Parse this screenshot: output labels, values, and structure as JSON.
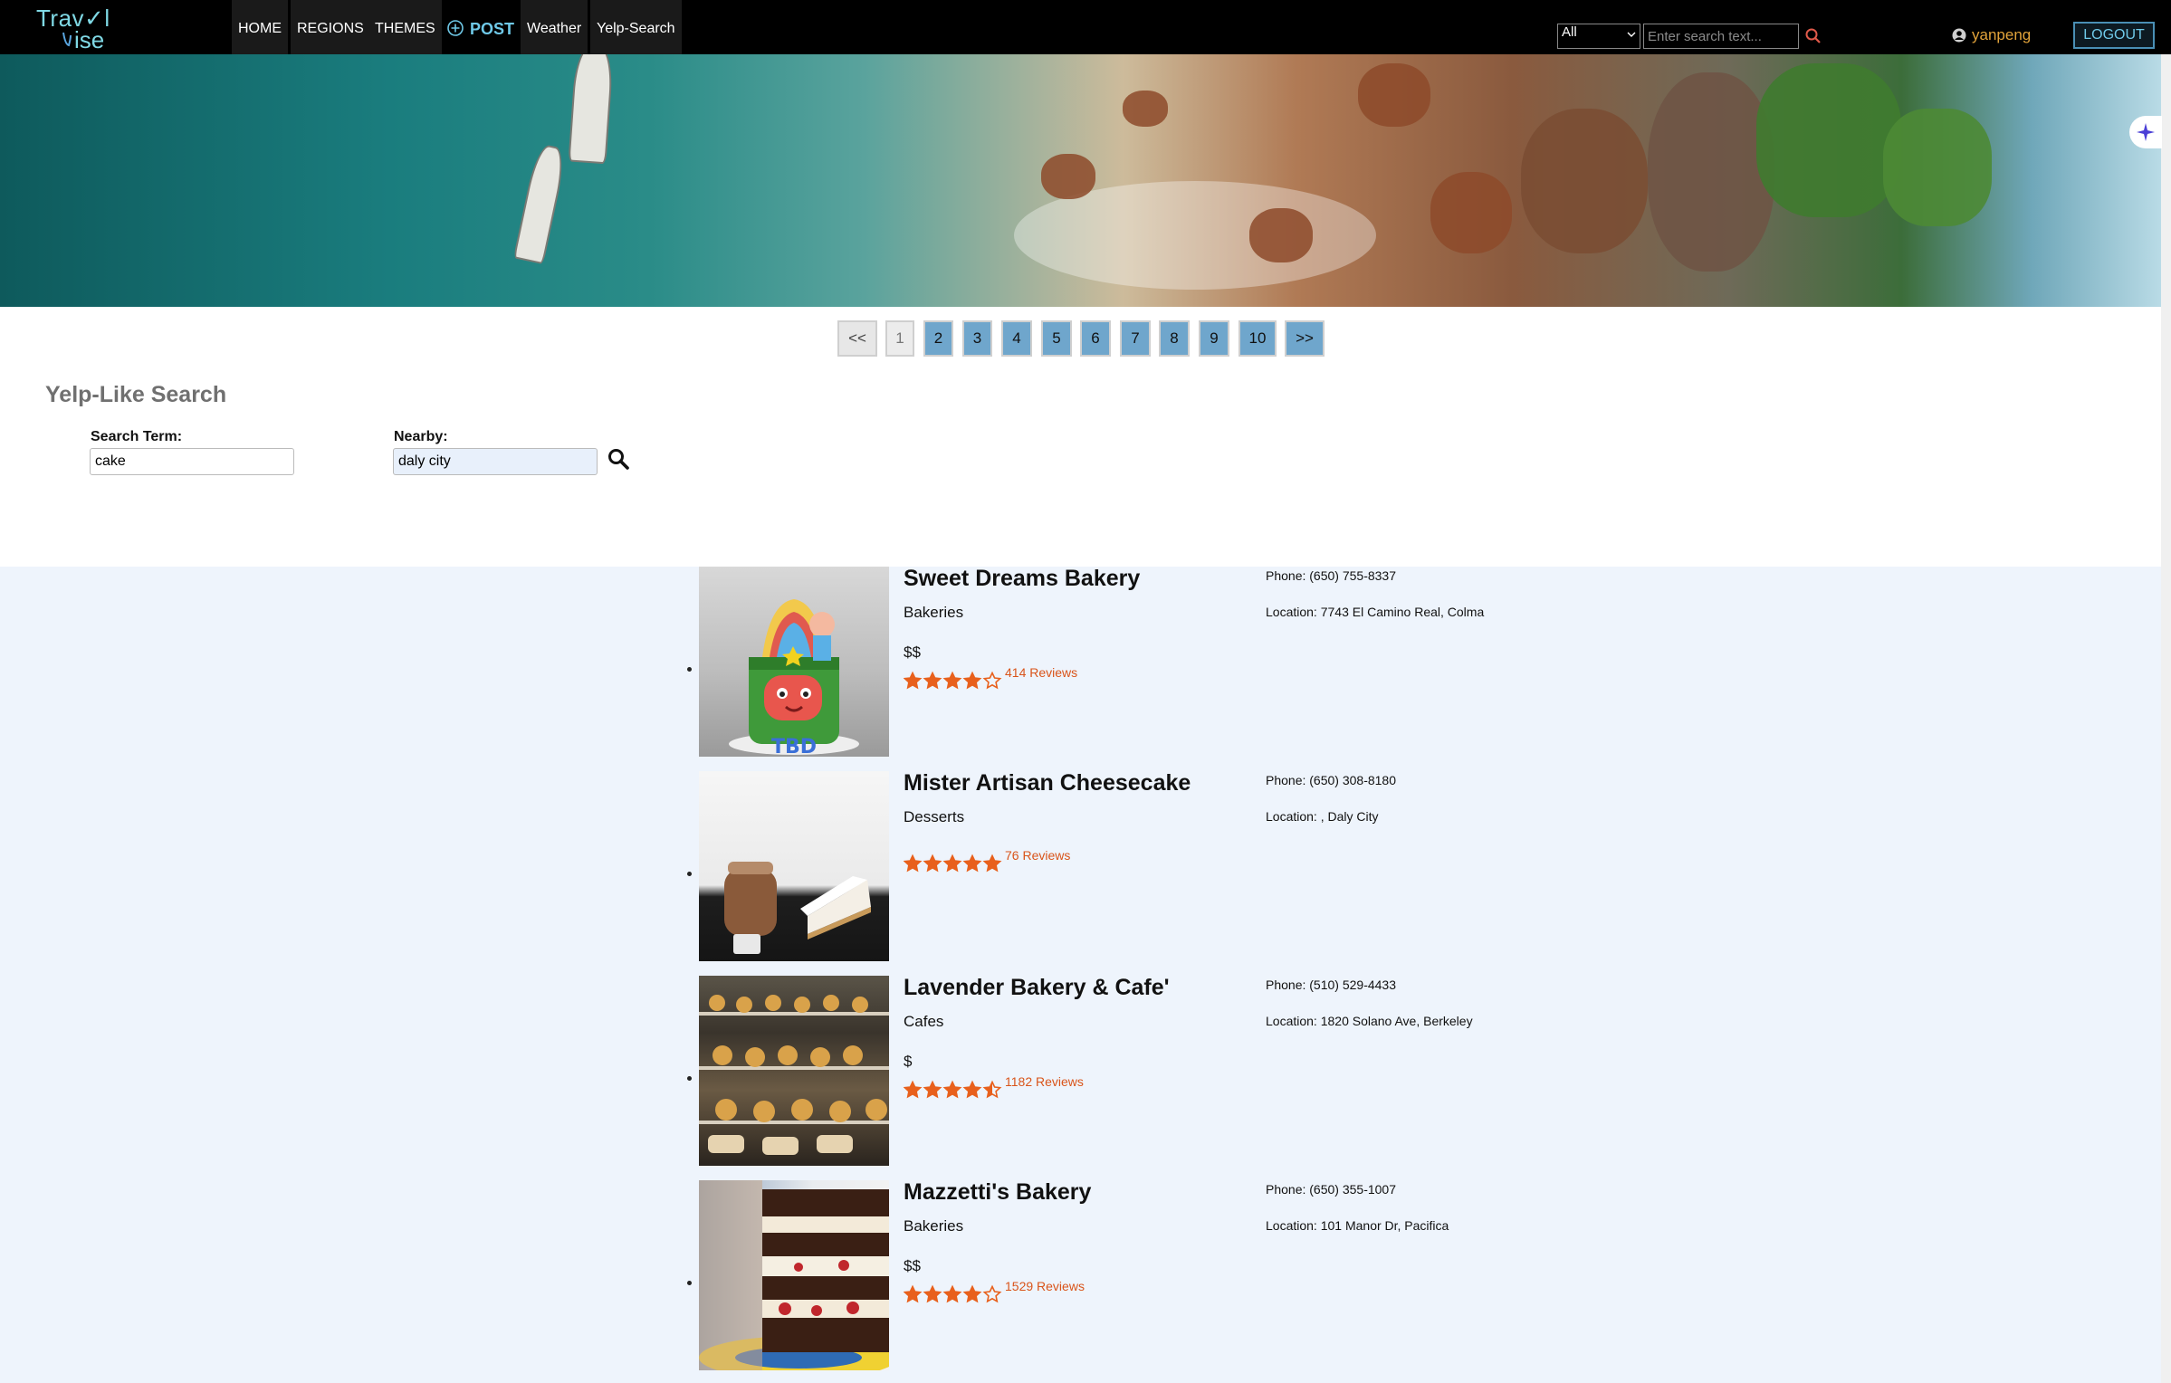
{
  "nav": {
    "logo_line1": "Trav✓l",
    "logo_line2": "ise",
    "items": [
      "HOME",
      "REGIONS",
      "THEMES",
      "POST",
      "Weather",
      "Yelp-Search"
    ],
    "search_select_value": "All",
    "search_placeholder": "Enter search text...",
    "username": "yanpeng",
    "logout": "LOGOUT"
  },
  "pagination": {
    "prev": "<<",
    "pages": [
      "1",
      "2",
      "3",
      "4",
      "5",
      "6",
      "7",
      "8",
      "9",
      "10"
    ],
    "current": "1",
    "next": ">>"
  },
  "search_form": {
    "title": "Yelp-Like Search",
    "term_label": "Search Term:",
    "term_value": "cake",
    "nearby_label": "Nearby:",
    "nearby_value": "daly city"
  },
  "results": [
    {
      "name": "Sweet Dreams Bakery",
      "category": "Bakeries",
      "price": "$$",
      "rating": 4,
      "reviews": "414 Reviews",
      "phone": "Phone: (650) 755-8337",
      "location": "Location: 7743 El Camino Real, Colma",
      "image_icon": "cake-photo"
    },
    {
      "name": "Mister Artisan Cheesecake",
      "category": "Desserts",
      "price": "",
      "rating": 5,
      "reviews": "76 Reviews",
      "phone": "Phone: (650) 308-8180",
      "location": "Location: , Daly City",
      "image_icon": "cheesecake-photo"
    },
    {
      "name": "Lavender Bakery & Cafe'",
      "category": "Cafes",
      "price": "$",
      "rating": 4.5,
      "reviews": "1182 Reviews",
      "phone": "Phone: (510) 529-4433",
      "location": "Location: 1820 Solano Ave, Berkeley",
      "image_icon": "pastry-case-photo"
    },
    {
      "name": "Mazzetti's Bakery",
      "category": "Bakeries",
      "price": "$$",
      "rating": 4,
      "reviews": "1529 Reviews",
      "phone": "Phone: (650) 355-1007",
      "location": "Location: 101 Manor Dr, Pacifica",
      "image_icon": "layer-cake-photo"
    }
  ],
  "colors": {
    "nav_bg": "#000000",
    "accent": "#6fc9e8",
    "user": "#e2a33a",
    "page_btn": "#6fa6cc",
    "star": "#e8601c",
    "review_link": "#d9541a",
    "results_bg": "#eef4fc"
  }
}
